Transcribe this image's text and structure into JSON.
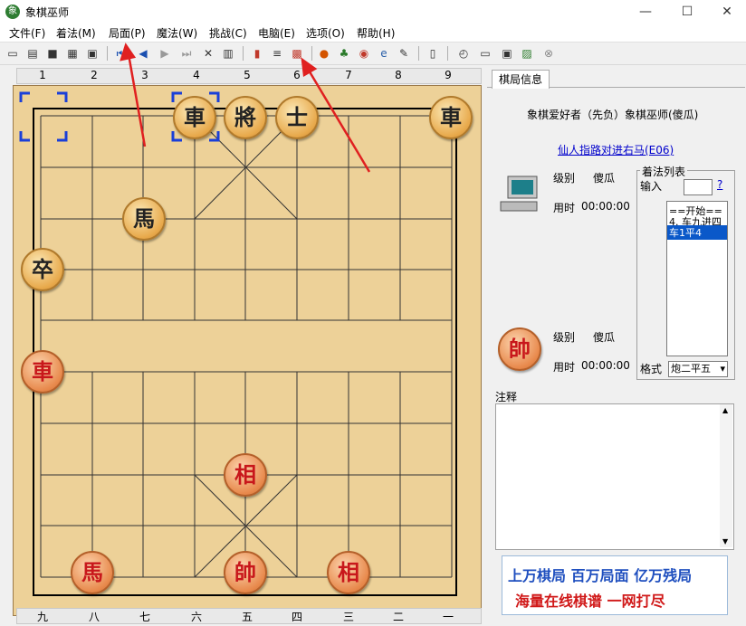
{
  "window": {
    "title": "象棋巫师",
    "app_icon": "象",
    "minimize": "—",
    "maximize": "☐",
    "close": "✕"
  },
  "menu": [
    "文件(F)",
    "着法(M)",
    "局面(P)",
    "魔法(W)",
    "挑战(C)",
    "电脑(E)",
    "选项(O)",
    "帮助(H)"
  ],
  "board": {
    "top_coords": [
      "1",
      "2",
      "3",
      "4",
      "5",
      "6",
      "7",
      "8",
      "9"
    ],
    "bottom_coords": [
      "九",
      "八",
      "七",
      "六",
      "五",
      "四",
      "三",
      "二",
      "一"
    ],
    "pieces": [
      {
        "name": "black-chariot-1",
        "char": "車",
        "side": "black"
      },
      {
        "name": "black-general",
        "char": "將",
        "side": "black"
      },
      {
        "name": "black-advisor",
        "char": "士",
        "side": "black"
      },
      {
        "name": "black-chariot-2",
        "char": "車",
        "side": "black"
      },
      {
        "name": "black-horse",
        "char": "馬",
        "side": "black"
      },
      {
        "name": "black-soldier",
        "char": "卒",
        "side": "black"
      },
      {
        "name": "red-chariot",
        "char": "車",
        "side": "red"
      },
      {
        "name": "red-elephant-1",
        "char": "相",
        "side": "red"
      },
      {
        "name": "red-horse",
        "char": "馬",
        "side": "red"
      },
      {
        "name": "red-king",
        "char": "帥",
        "side": "red"
      },
      {
        "name": "red-elephant-2",
        "char": "相",
        "side": "red"
      }
    ]
  },
  "panel": {
    "tab": "棋局信息",
    "players": "象棋爱好者（先负）象棋巫师(傻瓜)",
    "opening": "仙人指路对进右马(E06)",
    "top_player": {
      "level_label": "级别",
      "level": "傻瓜",
      "time_label": "用时",
      "time": "00:00:00"
    },
    "bottom_player": {
      "level_label": "级别",
      "level": "傻瓜",
      "time_label": "用时",
      "time": "00:00:00",
      "king_char": "帥"
    },
    "movelist": {
      "title": "着法列表",
      "input_label": "输入",
      "help": "?",
      "moves": [
        "==开始==",
        "4. 车九进四",
        "车1平4"
      ],
      "selected": 2
    },
    "format_label": "格式",
    "format_value": "炮二平五",
    "notes_label": "注释"
  },
  "ad": {
    "line1": "上万棋局 百万局面 亿万残局",
    "line2": "海量在线棋谱 一网打尽"
  }
}
